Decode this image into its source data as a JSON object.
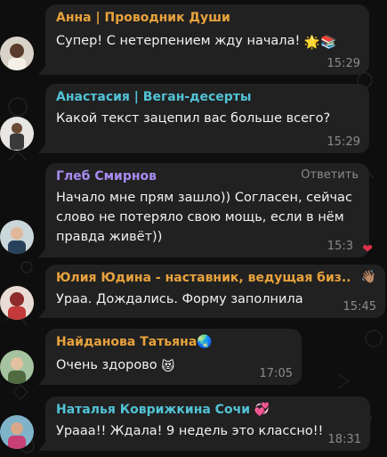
{
  "colors": {
    "background": "#0e0e0e",
    "bubble": "#212121",
    "name_orange": "#e8a23c",
    "name_cyan": "#52c3d6",
    "name_purple": "#a88bf0"
  },
  "messages": [
    {
      "author": "Анна | Проводник Души",
      "text": "Супер! С нетерпением жду начала!",
      "emojis": "🌟📚",
      "time": "15:29"
    },
    {
      "author": "Анастасия | Веган-десерты",
      "text": "Какой текст зацепил вас больше всего?",
      "time": "15:29"
    },
    {
      "author": "Глеб Смирнов",
      "reply_label": "Ответить",
      "text_lines": [
        "Начало мне прям зашло)) Согласен, сейчас",
        "слово не потеряло свою мощь, если в нём",
        "правда живёт))"
      ],
      "time": "15:3",
      "reaction": "❤"
    },
    {
      "author": "Юлия Юдина - наставник, ведущая биз...",
      "reaction_icon": "👋🏽",
      "text": "Ураа. Дождались. Форму заполнила",
      "time": "15:45"
    },
    {
      "author": "Найданова Татьяна",
      "author_emoji": "🌏",
      "text": "Очень здорово",
      "emojis": "😻",
      "time": "17:05"
    },
    {
      "author": "Наталья Коврижкина Сочи",
      "author_emoji": "💞",
      "text": "Урааа!! Ждала! 9 недель это классно!!",
      "time": "18:31"
    }
  ]
}
